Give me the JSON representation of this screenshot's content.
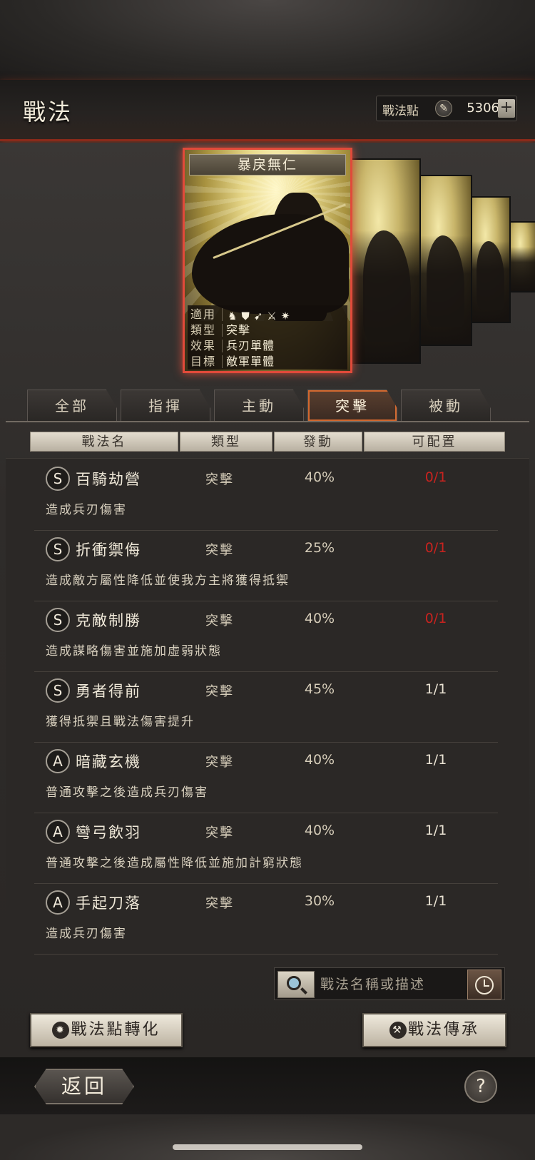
{
  "header": {
    "title": "戰法",
    "points_label": "戰法點",
    "points_value": "5306",
    "add_label": "+"
  },
  "featured_card": {
    "name": "暴戾無仁",
    "info": [
      {
        "key": "適用",
        "value": ""
      },
      {
        "key": "類型",
        "value": "突擊"
      },
      {
        "key": "效果",
        "value": "兵刃單體"
      },
      {
        "key": "目標",
        "value": "敵軍單體"
      }
    ],
    "unit_icons": [
      "cavalry-icon",
      "shield-icon",
      "bow-icon",
      "spear-icon",
      "wheel-icon"
    ]
  },
  "tabs": [
    {
      "label": "全部",
      "active": false
    },
    {
      "label": "指揮",
      "active": false
    },
    {
      "label": "主動",
      "active": false
    },
    {
      "label": "突擊",
      "active": true
    },
    {
      "label": "被動",
      "active": false
    }
  ],
  "table": {
    "headers": [
      "戰法名",
      "類型",
      "發動",
      "可配置"
    ],
    "rows": [
      {
        "grade": "S",
        "name": "百騎劫營",
        "type": "突擊",
        "rate": "40%",
        "slots": "0/1",
        "full": true,
        "desc": "造成兵刃傷害"
      },
      {
        "grade": "S",
        "name": "折衝禦侮",
        "type": "突擊",
        "rate": "25%",
        "slots": "0/1",
        "full": true,
        "desc": "造成敵方屬性降低並使我方主將獲得抵禦"
      },
      {
        "grade": "S",
        "name": "克敵制勝",
        "type": "突擊",
        "rate": "40%",
        "slots": "0/1",
        "full": true,
        "desc": "造成謀略傷害並施加虛弱狀態"
      },
      {
        "grade": "S",
        "name": "勇者得前",
        "type": "突擊",
        "rate": "45%",
        "slots": "1/1",
        "full": false,
        "desc": "獲得抵禦且戰法傷害提升"
      },
      {
        "grade": "A",
        "name": "暗藏玄機",
        "type": "突擊",
        "rate": "40%",
        "slots": "1/1",
        "full": false,
        "desc": "普通攻擊之後造成兵刃傷害"
      },
      {
        "grade": "A",
        "name": "彎弓飲羽",
        "type": "突擊",
        "rate": "40%",
        "slots": "1/1",
        "full": false,
        "desc": "普通攻擊之後造成屬性降低並施加計窮狀態"
      },
      {
        "grade": "A",
        "name": "手起刀落",
        "type": "突擊",
        "rate": "30%",
        "slots": "1/1",
        "full": false,
        "desc": "造成兵刃傷害"
      }
    ]
  },
  "search": {
    "placeholder": "戰法名稱或描述"
  },
  "actions": {
    "convert_label": "戰法點轉化",
    "inherit_label": "戰法傳承"
  },
  "footer": {
    "back_label": "返回",
    "help_label": "?"
  },
  "colors": {
    "accent_red": "#e04a3a",
    "full_slot_red": "#c8231f",
    "active_tab_border": "#d2682f"
  }
}
